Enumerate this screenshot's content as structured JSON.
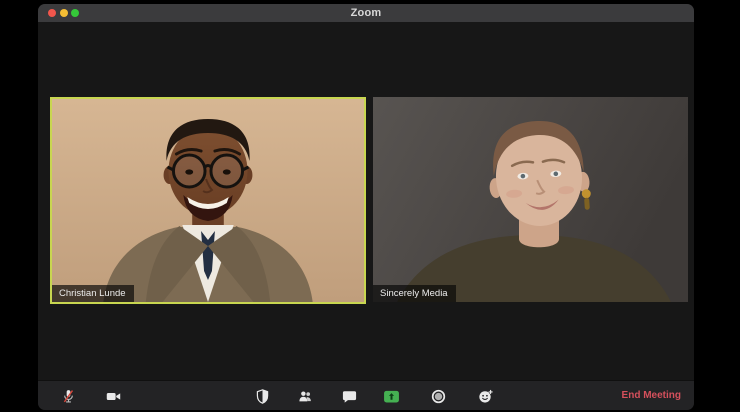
{
  "window": {
    "title": "Zoom",
    "traffic_lights": [
      {
        "id": "close-button",
        "icon": "traffic-red-icon"
      },
      {
        "id": "minimize-button",
        "icon": "traffic-yellow-icon"
      },
      {
        "id": "zoom-button",
        "icon": "traffic-green-icon"
      }
    ]
  },
  "participants": [
    {
      "name": "Christian Lunde",
      "active_speaker": true
    },
    {
      "name": "Sincerely Media",
      "active_speaker": false
    }
  ],
  "toolbar": {
    "buttons": [
      {
        "icon": "microphone-muted-icon"
      },
      {
        "icon": "video-camera-icon"
      },
      {
        "icon": "security-shield-icon"
      },
      {
        "icon": "participants-icon"
      },
      {
        "icon": "chat-bubble-icon"
      },
      {
        "icon": "share-screen-icon"
      },
      {
        "icon": "record-icon"
      },
      {
        "icon": "reactions-icon"
      }
    ],
    "end_meeting_label": "End Meeting"
  },
  "colors": {
    "traffic_red": "#f2564c",
    "traffic_yellow": "#f5be34",
    "traffic_green": "#35c839",
    "active_speaker_border": "#c8d650",
    "share_screen_green": "#45b052",
    "end_meeting_red": "#d5505c"
  }
}
